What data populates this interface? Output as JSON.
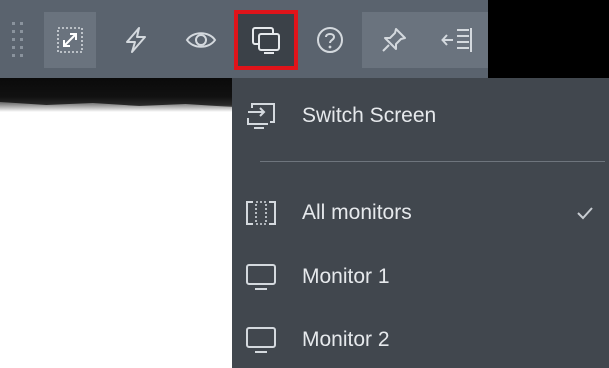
{
  "toolbar": {
    "buttons": [
      {
        "id": "fit-screen",
        "icon": "fit-to-screen-icon",
        "pressed": true
      },
      {
        "id": "actions",
        "icon": "lightning-icon",
        "pressed": false
      },
      {
        "id": "view-only",
        "icon": "eye-icon",
        "pressed": false
      },
      {
        "id": "switch-screen",
        "icon": "switch-screen-icon",
        "pressed": false,
        "highlighted": true
      },
      {
        "id": "help",
        "icon": "question-circle-icon",
        "pressed": false
      },
      {
        "id": "pin",
        "icon": "pin-icon",
        "pressed": true
      },
      {
        "id": "collapse",
        "icon": "collapse-menu-icon",
        "pressed": true
      }
    ],
    "highlight_color": "#e0141a"
  },
  "menu": {
    "header": {
      "label": "Switch Screen",
      "icon": "switch-screen-header-icon"
    },
    "items": [
      {
        "label": "All monitors",
        "icon": "all-monitors-icon",
        "checked": true
      },
      {
        "label": "Monitor 1",
        "icon": "monitor-icon",
        "checked": false
      },
      {
        "label": "Monitor 2",
        "icon": "monitor-icon",
        "checked": false
      }
    ]
  },
  "colors": {
    "toolbar_bg": "#5a636e",
    "menu_bg": "#41474e",
    "text": "#e6e9ec",
    "icon": "#d4d9de"
  }
}
